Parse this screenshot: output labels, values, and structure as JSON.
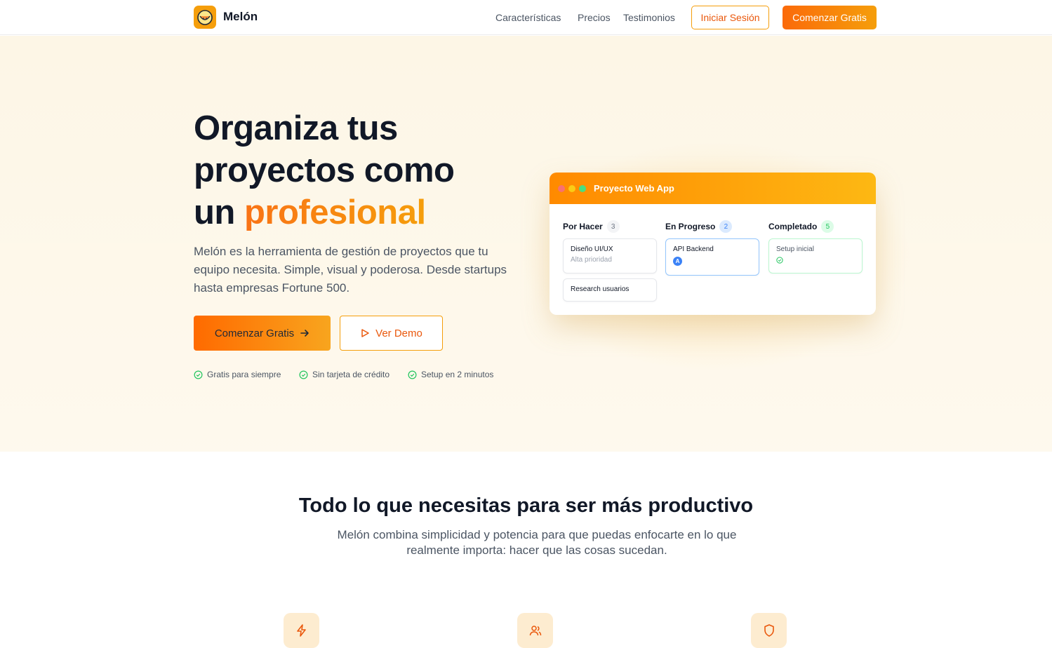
{
  "nav": {
    "brand": "Melón",
    "links": [
      "Características",
      "Precios",
      "Testimonios"
    ],
    "login": "Iniciar Sesión",
    "start": "Comenzar Gratis"
  },
  "hero": {
    "title_line1": "Organiza tus",
    "title_line2": "proyectos como",
    "title_line3_prefix": "un",
    "title_accent": "profesional",
    "lead": "Melón es la herramienta de gestión de proyectos que tu equipo necesita. Simple, visual y poderosa. Desde startups hasta empresas Fortune 500.",
    "cta_primary": "Comenzar Gratis",
    "cta_secondary": "Ver Demo",
    "perks": [
      "Gratis para siempre",
      "Sin tarjeta de crédito",
      "Setup en 2 minutos"
    ]
  },
  "board": {
    "title": "Proyecto Web App",
    "columns": [
      {
        "title": "Por Hacer",
        "count": "3"
      },
      {
        "title": "En Progreso",
        "count": "2"
      },
      {
        "title": "Completado",
        "count": "5"
      }
    ],
    "tasks": {
      "todo1_title": "Diseño UI/UX",
      "todo1_sub": "Alta prioridad",
      "todo2_title": "Research usuarios",
      "prog1_title": "API Backend",
      "prog1_avatar": "A",
      "done1_title": "Setup inicial"
    }
  },
  "features": {
    "title": "Todo lo que necesitas para ser más productivo",
    "subtitle": "Melón combina simplicidad y potencia para que puedas enfocarte en lo que realmente importa: hacer que las cosas sucedan.",
    "icons": [
      "lightning-icon",
      "users-icon",
      "shield-icon"
    ]
  },
  "colors": {
    "accent": "#f97316",
    "accent2": "#f59e0b",
    "success": "#22c55e",
    "info": "#3b82f6"
  }
}
